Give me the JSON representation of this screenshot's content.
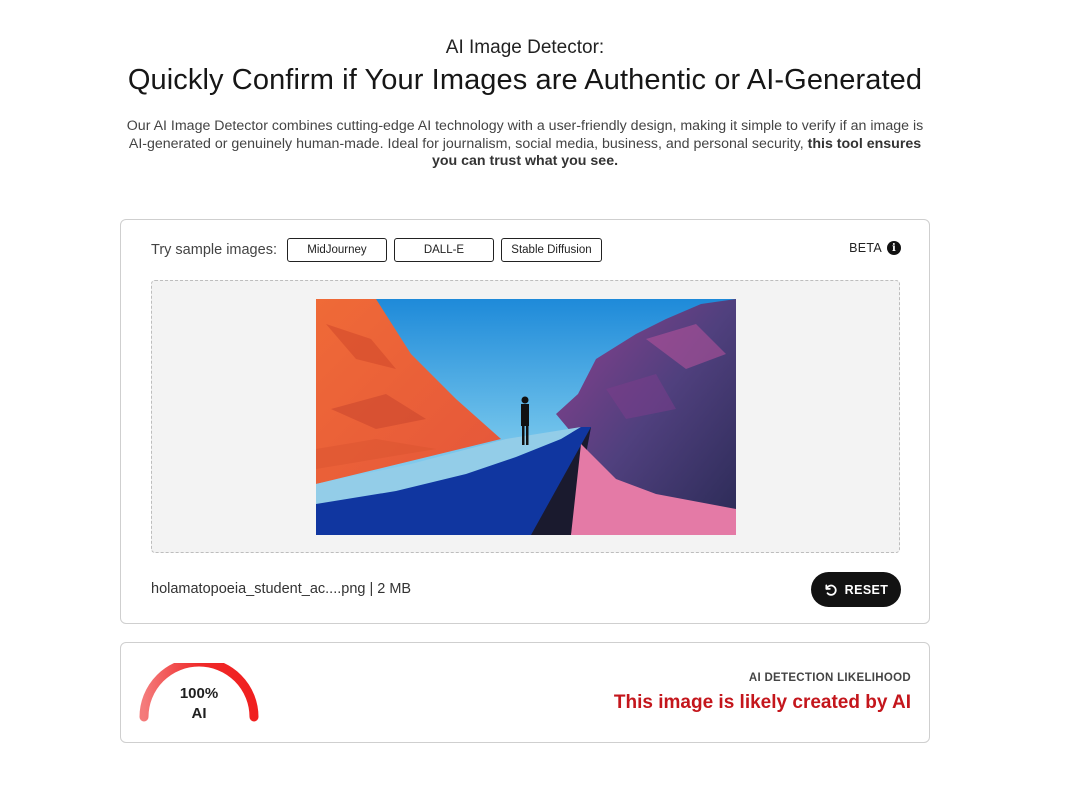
{
  "hero": {
    "kicker": "AI Image Detector:",
    "title": "Quickly Confirm if Your Images are Authentic or AI-Generated",
    "description": "Our AI Image Detector combines cutting-edge AI technology with a user-friendly design, making it simple to verify if an image is AI-generated or genuinely human-made. Ideal for journalism, social media, business, and personal security,",
    "description_bold": "this tool ensures you can trust what you see."
  },
  "samples": {
    "label": "Try sample images:",
    "options": [
      "MidJourney",
      "DALL-E",
      "Stable Diffusion"
    ]
  },
  "beta": {
    "label": "BETA",
    "icon": "info-icon"
  },
  "file": {
    "info": "holamatopoeia_student_ac....png | 2 MB"
  },
  "reset": {
    "label": "RESET",
    "icon": "reset-icon"
  },
  "result": {
    "gauge_value": "100%",
    "gauge_unit": "AI",
    "score": 100,
    "likelihood_title": "AI DETECTION LIKELIHOOD",
    "likelihood_text": "This image is likely created by AI"
  },
  "colors": {
    "accent_red": "#c4161c",
    "gauge_red": "#ef2a2a",
    "button_dark": "#121212"
  }
}
